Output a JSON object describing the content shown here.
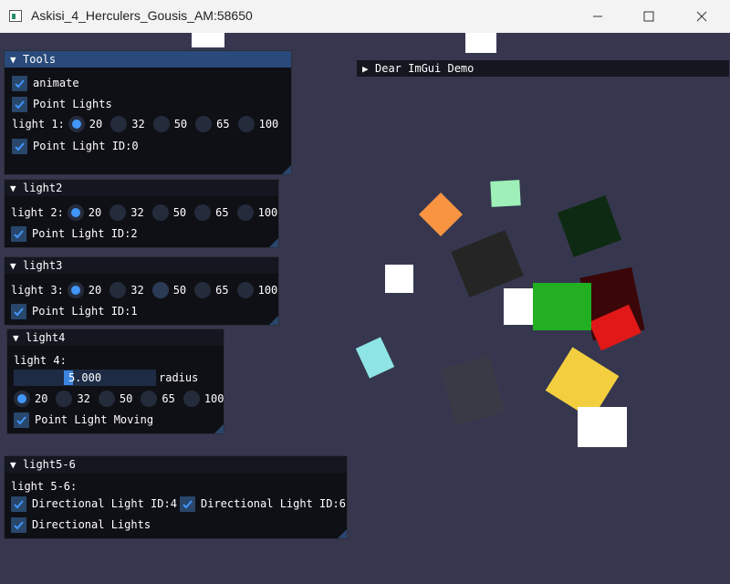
{
  "window": {
    "title": "Askisi_4_Herculers_Gousis_AM:58650",
    "minimize_icon": "minimize-icon",
    "maximize_icon": "maximize-icon",
    "close_icon": "close-icon"
  },
  "radio_options": [
    "20",
    "32",
    "50",
    "65",
    "100"
  ],
  "tools": {
    "title": "Tools",
    "animate": "animate",
    "point_lights": "Point Lights",
    "light_label": "light 1:",
    "selected": "20",
    "id_label": "Point Light ID:0"
  },
  "light2": {
    "title": "light2",
    "light_label": "light 2:",
    "selected": "20",
    "id_label": "Point Light ID:2"
  },
  "light3": {
    "title": "light3",
    "light_label": "light 3:",
    "selected": "20",
    "id_label": "Point Light ID:1"
  },
  "light4": {
    "title": "light4",
    "light_label": "light 4:",
    "slider_value": "5.000",
    "slider_label": "radius",
    "selected": "20",
    "moving_label": "Point Light Moving"
  },
  "light56": {
    "title": "light5-6",
    "light_label": "light 5-6:",
    "dir4": "Directional Light ID:4",
    "dir6": "Directional Light ID:6",
    "dir_lights": "Directional Lights"
  },
  "demo": {
    "title": "Dear ImGui Demo"
  },
  "colors": {
    "checkbox": "#29466b",
    "check_mark": "#4296fa",
    "title_active": "#294a7a",
    "background": "#36374f"
  }
}
